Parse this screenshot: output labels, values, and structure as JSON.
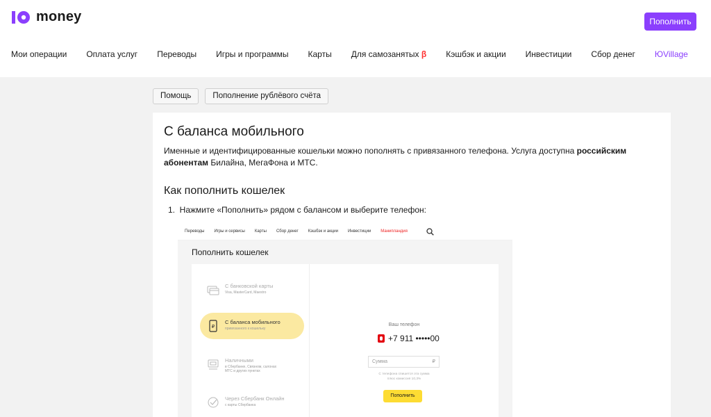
{
  "header": {
    "logo_text": "money",
    "topup_button": "Пополнить",
    "nav": [
      {
        "label": "Мои операции"
      },
      {
        "label": "Оплата услуг"
      },
      {
        "label": "Переводы"
      },
      {
        "label": "Игры и программы"
      },
      {
        "label": "Карты"
      },
      {
        "label": "Для самозанятых",
        "badge": "β"
      },
      {
        "label": "Кэшбэк и акции"
      },
      {
        "label": "Инвестиции"
      },
      {
        "label": "Сбор денег"
      },
      {
        "label": "ЮVillage"
      }
    ]
  },
  "breadcrumbs": [
    "Помощь",
    "Пополнение рублёвого счёта"
  ],
  "article": {
    "title": "С баланса мобильного",
    "intro_part1": "Именные и идентифицированные кошельки можно пополнять с привязанного телефона. Услуга доступна ",
    "intro_bold": "российским абонентам",
    "intro_part2": " Билайна, МегаФона и МТС.",
    "subtitle": "Как пополнить кошелек",
    "step1": "1.  Нажмите «Пополнить» рядом с балансом и выберите телефон:"
  },
  "screenshot": {
    "nav": [
      "Переводы",
      "Игры и сервисы",
      "Карты",
      "Сбор денег",
      "Кэшбэк и акции",
      "Инвестиции",
      "Манипландия"
    ],
    "title": "Пополнить кошелек",
    "options": [
      {
        "title": "С банковской карты",
        "sub": "Visa, MasterCard, Maestro"
      },
      {
        "title": "С баланса мобильного",
        "sub": "привязанного к кошельку"
      },
      {
        "title": "Наличными",
        "sub": "в Сбербанке, Связном, салонах\nМТС и других пунктах"
      },
      {
        "title": "Через Сбербанк Онлайн",
        "sub": "с карты Сбербанка"
      }
    ],
    "phone_label": "Ваш телефон",
    "phone_number": "+7 911 •••••00",
    "sum_placeholder": "Сумма",
    "currency": "₽",
    "note": "С телефона спишется эта сумма\nплюс комиссия 10,3%",
    "button": "Пополнить"
  }
}
